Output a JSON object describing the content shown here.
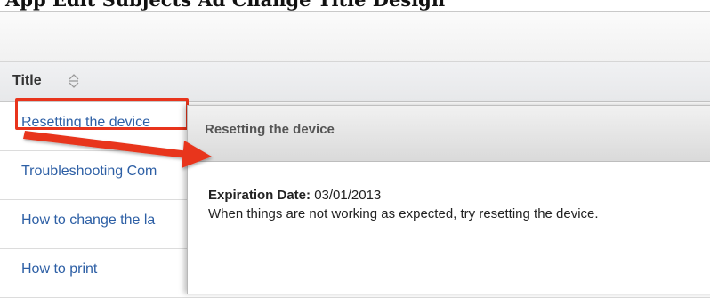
{
  "caption": "App Edit Subjects Ad Change Title Design",
  "list": {
    "header": {
      "title_label": "Title",
      "sort_icon": "sort-arrows-icon"
    },
    "rows": [
      {
        "title": "Resetting the device"
      },
      {
        "title": "Troubleshooting Com"
      },
      {
        "title": "How to change the la"
      },
      {
        "title": "How to print"
      }
    ]
  },
  "preview": {
    "title": "Resetting the device",
    "expiration_label": "Expiration Date:",
    "expiration_value": "03/01/2013",
    "body": "When things are not working as expected, try resetting the device."
  },
  "colors": {
    "link": "#2d5fa5",
    "highlight": "#e8341c",
    "arrow": "#e8341c"
  }
}
